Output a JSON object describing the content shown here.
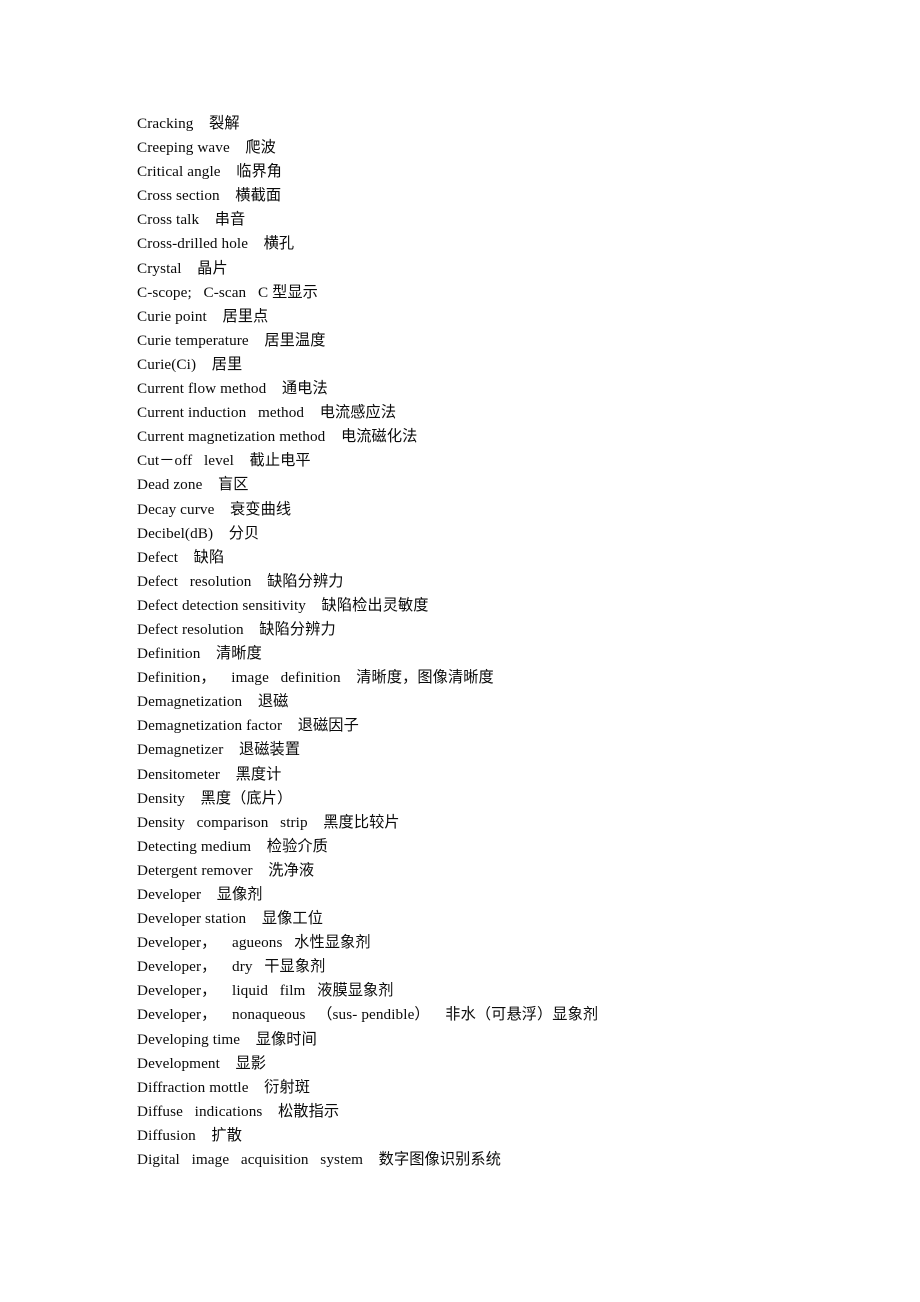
{
  "document": {
    "type": "glossary-page",
    "language_pair": "English-Chinese",
    "subject": "Non-destructive testing terminology",
    "background_color": "#ffffff",
    "text_color": "#000000",
    "entry_count": 44
  },
  "entries": [
    {
      "term": "Cracking",
      "translation": "裂解",
      "line": "Cracking    裂解"
    },
    {
      "term": "Creeping wave",
      "translation": "爬波",
      "line": "Creeping wave    爬波"
    },
    {
      "term": "Critical angle",
      "translation": "临界角",
      "line": "Critical angle    临界角"
    },
    {
      "term": "Cross section",
      "translation": "横截面",
      "line": "Cross section    横截面"
    },
    {
      "term": "Cross talk",
      "translation": "串音",
      "line": "Cross talk    串音"
    },
    {
      "term": "Cross-drilled hole",
      "translation": "横孔",
      "line": "Cross-drilled hole    横孔"
    },
    {
      "term": "Crystal",
      "translation": "晶片",
      "line": "Crystal    晶片"
    },
    {
      "term": "C-scope;  C-scan",
      "translation": "C 型显示",
      "line": "C-scope;   C-scan   C 型显示"
    },
    {
      "term": "Curie point",
      "translation": "居里点",
      "line": "Curie point    居里点"
    },
    {
      "term": "Curie temperature",
      "translation": "居里温度",
      "line": "Curie temperature    居里温度"
    },
    {
      "term": "Curie(Ci)",
      "translation": "居里",
      "line": "Curie(Ci)    居里"
    },
    {
      "term": "Current flow method",
      "translation": "通电法",
      "line": "Current flow method    通电法"
    },
    {
      "term": "Current induction  method",
      "translation": "电流感应法",
      "line": "Current induction   method    电流感应法"
    },
    {
      "term": "Current magnetization method",
      "translation": "电流磁化法",
      "line": "Current magnetization method    电流磁化法"
    },
    {
      "term": "Cut－off  level",
      "translation": "截止电平",
      "line": "Cut－off   level    截止电平"
    },
    {
      "term": "Dead zone",
      "translation": "盲区",
      "line": "Dead zone    盲区"
    },
    {
      "term": "Decay curve",
      "translation": "衰变曲线",
      "line": "Decay curve    衰变曲线"
    },
    {
      "term": "Decibel(dB)",
      "translation": "分贝",
      "line": "Decibel(dB)    分贝"
    },
    {
      "term": "Defect",
      "translation": "缺陷",
      "line": "Defect    缺陷"
    },
    {
      "term": "Defect  resolution",
      "translation": "缺陷分辨力",
      "line": "Defect   resolution    缺陷分辨力"
    },
    {
      "term": "Defect detection sensitivity",
      "translation": "缺陷检出灵敏度",
      "line": "Defect detection sensitivity    缺陷检出灵敏度"
    },
    {
      "term": "Defect resolution",
      "translation": "缺陷分辨力",
      "line": "Defect resolution    缺陷分辨力"
    },
    {
      "term": "Definition",
      "translation": "清晰度",
      "line": "Definition    清晰度"
    },
    {
      "term": "Definition，  image  definition",
      "translation": "清晰度，图像清晰度",
      "line": "Definition，    image   definition    清晰度，图像清晰度"
    },
    {
      "term": "Demagnetization",
      "translation": "退磁",
      "line": "Demagnetization    退磁"
    },
    {
      "term": "Demagnetization factor",
      "translation": "退磁因子",
      "line": "Demagnetization factor    退磁因子"
    },
    {
      "term": "Demagnetizer",
      "translation": "退磁装置",
      "line": "Demagnetizer    退磁装置"
    },
    {
      "term": "Densitometer",
      "translation": "黑度计",
      "line": "Densitometer    黑度计"
    },
    {
      "term": "Density",
      "translation": "黑度（底片）",
      "line": "Density    黑度（底片）"
    },
    {
      "term": "Density  comparison  strip",
      "translation": "黑度比较片",
      "line": "Density   comparison   strip    黑度比较片"
    },
    {
      "term": "Detecting medium",
      "translation": "检验介质",
      "line": "Detecting medium    检验介质"
    },
    {
      "term": "Detergent remover",
      "translation": "洗净液",
      "line": "Detergent remover    洗净液"
    },
    {
      "term": "Developer",
      "translation": "显像剂",
      "line": "Developer    显像剂"
    },
    {
      "term": "Developer station",
      "translation": "显像工位",
      "line": "Developer station    显像工位"
    },
    {
      "term": "Developer，  agueons",
      "translation": "水性显象剂",
      "line": "Developer，    agueons   水性显象剂"
    },
    {
      "term": "Developer，  dry",
      "translation": "干显象剂",
      "line": "Developer，    dry   干显象剂"
    },
    {
      "term": "Developer，  liquid  film",
      "translation": "液膜显象剂",
      "line": "Developer，    liquid   film   液膜显象剂"
    },
    {
      "term": "Developer，  nonaqueous（sus- pendible）",
      "translation": "非水（可悬浮）显象剂",
      "line": "Developer，    nonaqueous   （sus- pendible）    非水（可悬浮）显象剂"
    },
    {
      "term": "Developing time",
      "translation": "显像时间",
      "line": "Developing time    显像时间"
    },
    {
      "term": "Development",
      "translation": "显影",
      "line": "Development    显影"
    },
    {
      "term": "Diffraction mottle",
      "translation": "衍射斑",
      "line": "Diffraction mottle    衍射斑"
    },
    {
      "term": "Diffuse  indications",
      "translation": "松散指示",
      "line": "Diffuse   indications    松散指示"
    },
    {
      "term": "Diffusion",
      "translation": "扩散",
      "line": "Diffusion    扩散"
    },
    {
      "term": "Digital  image  acquisition  system",
      "translation": "数字图像识别系统",
      "line": "Digital   image   acquisition   system    数字图像识别系统"
    }
  ]
}
